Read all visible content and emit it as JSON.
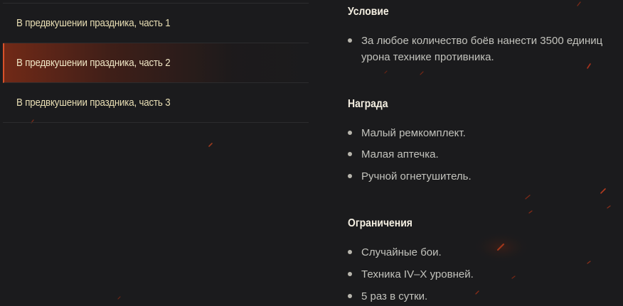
{
  "quest_list": [
    {
      "label": "В предвкушении праздника, часть 1",
      "active": false
    },
    {
      "label": "В предвкушении праздника, часть 2",
      "active": true
    },
    {
      "label": "В предвкушении праздника, часть 3",
      "active": false
    }
  ],
  "details": {
    "condition": {
      "title": "Условие",
      "items": [
        "За любое количество боёв нанести 3500 единиц урона технике противника."
      ]
    },
    "reward": {
      "title": "Награда",
      "items": [
        "Малый ремкомплект.",
        "Малая аптечка.",
        "Ручной огнетушитель."
      ]
    },
    "restrictions": {
      "title": "Ограничения",
      "items": [
        "Случайные бои.",
        "Техника IV–X уровней.",
        "5 раз в сутки."
      ]
    }
  },
  "colors": {
    "background": "#1b1b1d",
    "accent": "#d8512a",
    "quest_text": "#e9dfb5",
    "heading": "#f4efe2",
    "body_text": "#c3c3bd"
  }
}
